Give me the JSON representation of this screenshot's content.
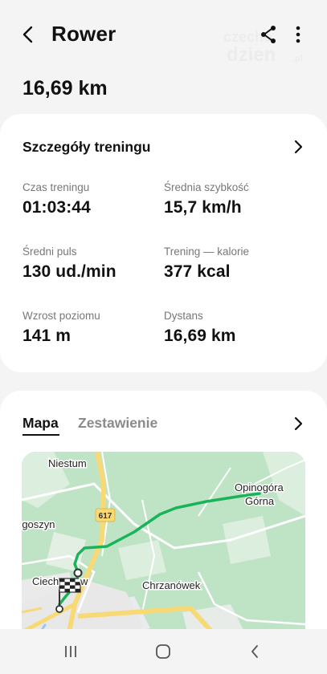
{
  "header": {
    "title": "Rower",
    "back_icon": "back-arrow-icon",
    "share_icon": "share-icon",
    "more_icon": "more-vertical-icon",
    "watermark": "czecho dzien pl"
  },
  "summary": {
    "distance": "16,69 km"
  },
  "details": {
    "title": "Szczegóły treningu",
    "stats": [
      {
        "label": "Czas treningu",
        "value": "01:03:44"
      },
      {
        "label": "Średnia szybkość",
        "value": "15,7 km/h"
      },
      {
        "label": "Średni puls",
        "value": "130 ud./min"
      },
      {
        "label": "Trening — kalorie",
        "value": "377 kcal"
      },
      {
        "label": "Wzrost poziomu",
        "value": "141 m"
      },
      {
        "label": "Dystans",
        "value": "16,69 km"
      }
    ]
  },
  "map_section": {
    "tabs": [
      {
        "label": "Mapa",
        "active": true
      },
      {
        "label": "Zestawienie",
        "active": false
      }
    ],
    "place_labels": {
      "niestum": "Niestum",
      "opinogora_1": "Opinogóra",
      "opinogora_2": "Górna",
      "goszyn": "rgoszyn",
      "road": "617",
      "ciechanow": "Ciech",
      "ciechanow_end": "w",
      "chrzanowek": "Chrzanówek"
    },
    "route_color": "#19b45a",
    "finish_icon": "checkered-flag-icon"
  },
  "navbar": {
    "recents_icon": "recents-icon",
    "home_icon": "home-icon",
    "back_icon": "nav-back-icon"
  }
}
